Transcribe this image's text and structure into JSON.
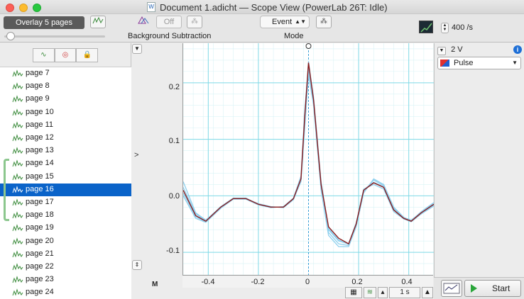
{
  "window": {
    "title": "Document 1.adicht — Scope View (PowerLab 26T: Idle)"
  },
  "toolbar": {
    "overlay_button": "Overlay 5 pages",
    "background_off": "Off",
    "background_label": "Background Subtraction",
    "mode_value": "Event",
    "mode_label": "Mode",
    "sample_rate": "400 /s"
  },
  "pages": [
    {
      "label": "page 7",
      "selected": false
    },
    {
      "label": "page 8",
      "selected": false
    },
    {
      "label": "page 9",
      "selected": false
    },
    {
      "label": "page 10",
      "selected": false
    },
    {
      "label": "page 11",
      "selected": false
    },
    {
      "label": "page 12",
      "selected": false
    },
    {
      "label": "page 13",
      "selected": false
    },
    {
      "label": "page 14",
      "selected": false
    },
    {
      "label": "page 15",
      "selected": false
    },
    {
      "label": "page 16",
      "selected": true
    },
    {
      "label": "page 17",
      "selected": false
    },
    {
      "label": "page 18",
      "selected": false
    },
    {
      "label": "page 19",
      "selected": false
    },
    {
      "label": "page 20",
      "selected": false
    },
    {
      "label": "page 21",
      "selected": false
    },
    {
      "label": "page 22",
      "selected": false
    },
    {
      "label": "page 23",
      "selected": false
    },
    {
      "label": "page 24",
      "selected": false
    }
  ],
  "channel": {
    "range": "2 V",
    "name": "Pulse",
    "colors": {
      "trace_selected": "#8b1a1a",
      "trace_overlay": "#8fd0ee",
      "grid": "#7fd9e6"
    }
  },
  "bottom": {
    "time_scale": "1 s",
    "start_label": "Start",
    "marker_label": "M"
  },
  "chart_data": {
    "type": "line",
    "xlim": [
      -0.5,
      0.5
    ],
    "ylim": [
      -0.14,
      0.27
    ],
    "x_ticks": [
      "-0.4",
      "-0.2",
      "0",
      "0.2",
      "0.4"
    ],
    "y_ticks": [
      "0.2",
      "0.1",
      "0.0",
      "-0.1"
    ],
    "x": [
      -0.5,
      -0.45,
      -0.41,
      -0.35,
      -0.3,
      -0.25,
      -0.2,
      -0.15,
      -0.1,
      -0.06,
      -0.03,
      -0.015,
      0.0,
      0.02,
      0.05,
      0.08,
      0.12,
      0.16,
      0.19,
      0.22,
      0.26,
      0.3,
      0.34,
      0.38,
      0.41,
      0.45,
      0.5
    ],
    "series": [
      {
        "values": [
          0.01,
          -0.035,
          -0.045,
          -0.02,
          -0.005,
          -0.005,
          -0.015,
          -0.02,
          -0.02,
          -0.005,
          0.03,
          0.14,
          0.235,
          0.17,
          0.02,
          -0.055,
          -0.075,
          -0.085,
          -0.05,
          0.01,
          0.023,
          0.015,
          -0.025,
          -0.04,
          -0.045,
          -0.03,
          -0.015
        ]
      },
      {
        "values": [
          0.025,
          -0.03,
          -0.043,
          -0.02,
          -0.004,
          -0.004,
          -0.015,
          -0.02,
          -0.02,
          -0.006,
          0.025,
          0.12,
          0.215,
          0.16,
          0.01,
          -0.07,
          -0.09,
          -0.09,
          -0.055,
          0.005,
          0.03,
          0.02,
          -0.02,
          -0.038,
          -0.044,
          -0.028,
          -0.012
        ]
      },
      {
        "values": [
          0.0,
          -0.04,
          -0.047,
          -0.022,
          -0.006,
          -0.006,
          -0.016,
          -0.021,
          -0.019,
          -0.004,
          0.035,
          0.15,
          0.23,
          0.175,
          0.025,
          -0.06,
          -0.08,
          -0.085,
          -0.048,
          0.012,
          0.02,
          0.012,
          -0.028,
          -0.041,
          -0.046,
          -0.032,
          -0.018
        ]
      },
      {
        "values": [
          0.015,
          -0.032,
          -0.044,
          -0.019,
          -0.004,
          -0.005,
          -0.014,
          -0.019,
          -0.021,
          -0.007,
          0.028,
          0.13,
          0.222,
          0.165,
          0.015,
          -0.065,
          -0.085,
          -0.088,
          -0.052,
          0.008,
          0.028,
          0.018,
          -0.022,
          -0.039,
          -0.043,
          -0.029,
          -0.014
        ]
      },
      {
        "values": [
          0.005,
          -0.037,
          -0.046,
          -0.021,
          -0.005,
          -0.004,
          -0.015,
          -0.02,
          -0.02,
          -0.005,
          0.032,
          0.145,
          0.238,
          0.172,
          0.022,
          -0.058,
          -0.078,
          -0.086,
          -0.051,
          0.011,
          0.024,
          0.016,
          -0.024,
          -0.04,
          -0.045,
          -0.031,
          -0.016
        ]
      }
    ]
  }
}
